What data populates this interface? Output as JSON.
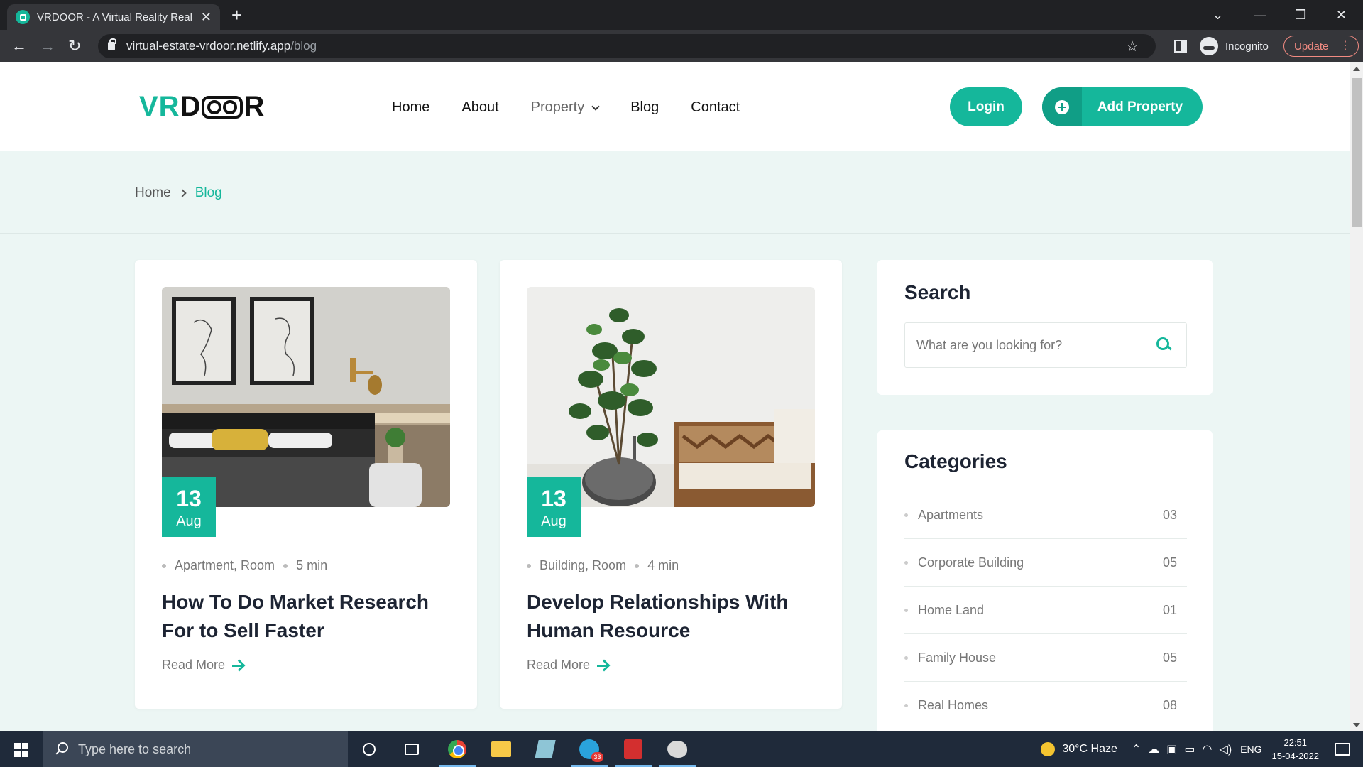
{
  "browser": {
    "tab_title": "VRDOOR - A Virtual Reality Real E",
    "new_tab": "+",
    "url_host": "virtual-estate-vrdoor.netlify.app",
    "url_path": "/blog",
    "incognito_label": "Incognito",
    "update_label": "Update"
  },
  "header": {
    "logo_vr": "VR",
    "logo_d": "D",
    "logo_r": "R",
    "nav": [
      "Home",
      "About",
      "Property",
      "Blog",
      "Contact"
    ],
    "login_label": "Login",
    "add_property_label": "Add Property"
  },
  "breadcrumb": {
    "home": "Home",
    "current": "Blog"
  },
  "posts": [
    {
      "day": "13",
      "month": "Aug",
      "categories": "Apartment, Room",
      "read_time": "5 min",
      "title": "How To Do Market Research For to Sell Faster",
      "read_more": "Read More"
    },
    {
      "day": "13",
      "month": "Aug",
      "categories": "Building, Room",
      "read_time": "4 min",
      "title": "Develop Relationships With Human Resource",
      "read_more": "Read More"
    }
  ],
  "sidebar": {
    "search_title": "Search",
    "search_placeholder": "What are you looking for?",
    "categories_title": "Categories",
    "categories": [
      {
        "name": "Apartments",
        "count": "03"
      },
      {
        "name": "Corporate Building",
        "count": "05"
      },
      {
        "name": "Home Land",
        "count": "01"
      },
      {
        "name": "Family House",
        "count": "05"
      },
      {
        "name": "Real Homes",
        "count": "08"
      }
    ]
  },
  "taskbar": {
    "search_placeholder": "Type here to search",
    "telegram_badge": "33",
    "weather": "30°C  Haze",
    "language": "ENG",
    "time": "22:51",
    "date": "15-04-2022"
  },
  "colors": {
    "accent": "#15b79b",
    "page_bg": "#ecf6f4",
    "chrome_dark": "#202124"
  }
}
